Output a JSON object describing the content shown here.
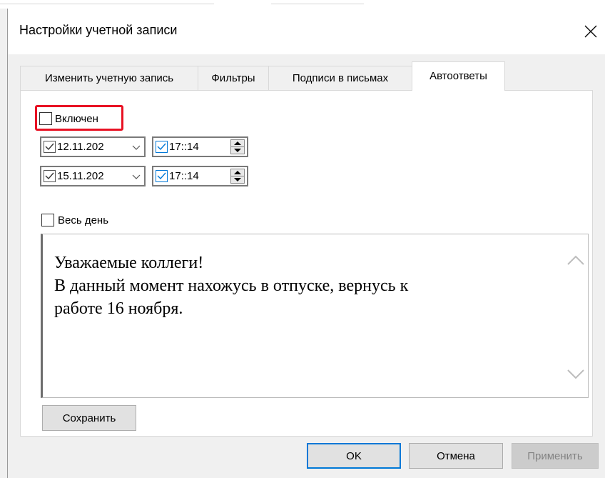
{
  "window": {
    "title": "Настройки учетной записи",
    "close_icon": "close-icon"
  },
  "tabs": [
    {
      "label": "Изменить учетную запись",
      "active": false
    },
    {
      "label": "Фильтры",
      "active": false
    },
    {
      "label": "Подписи в письмах",
      "active": false
    },
    {
      "label": "Автоответы",
      "active": true
    }
  ],
  "autoreply": {
    "enabled_label": "Включен",
    "enabled_checked": false,
    "start": {
      "date": "12.11.202",
      "date_checked": true,
      "time": "17::14",
      "time_checked": true
    },
    "end": {
      "date": "15.11.202",
      "date_checked": true,
      "time": "17::14",
      "time_checked": true
    },
    "all_day_label": "Весь день",
    "all_day_checked": false,
    "message_lines": [
      "Уважаемые коллеги!",
      "В данный момент нахожусь в отпуске, вернусь к",
      "работе 16 ноября."
    ],
    "save_label": "Сохранить"
  },
  "footer": {
    "ok_label": "OK",
    "cancel_label": "Отмена",
    "apply_label": "Применить",
    "apply_enabled": false
  },
  "colors": {
    "highlight": "#e81123",
    "accent": "#0078d7"
  }
}
